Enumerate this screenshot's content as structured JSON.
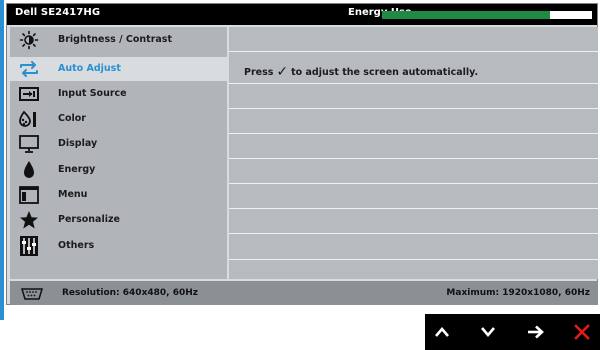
{
  "osd": {
    "model": "Dell SE2417HG",
    "energy_use": {
      "label": "Energy Use",
      "level": 0.8
    }
  },
  "menu": {
    "items": [
      {
        "label": "Brightness / Contrast",
        "icon": "brightness-icon",
        "active": false
      },
      {
        "label": "Auto Adjust",
        "icon": "auto-adjust-icon",
        "active": true
      },
      {
        "label": "Input Source",
        "icon": "input-source-icon",
        "active": false
      },
      {
        "label": "Color",
        "icon": "color-icon",
        "active": false
      },
      {
        "label": "Display",
        "icon": "display-icon",
        "active": false
      },
      {
        "label": "Energy",
        "icon": "energy-icon",
        "active": false
      },
      {
        "label": "Menu",
        "icon": "menu-icon",
        "active": false
      },
      {
        "label": "Personalize",
        "icon": "star-icon",
        "active": false
      },
      {
        "label": "Others",
        "icon": "others-icon",
        "active": false
      }
    ]
  },
  "content": {
    "instruction_before": "Press",
    "instruction_check": "✓",
    "instruction_after": "to adjust the screen automatically."
  },
  "status": {
    "resolution": "Resolution: 640x480, 60Hz",
    "maximum": "Maximum: 1920x1080, 60Hz",
    "icon": "vga-connector-icon"
  },
  "nav": {
    "buttons": [
      "up-arrow-icon",
      "down-arrow-icon",
      "right-arrow-icon",
      "close-icon"
    ]
  },
  "colors": {
    "accent": "#2c8fd1",
    "energy_bar": "#1f8a44",
    "close": "#e01b1b"
  }
}
